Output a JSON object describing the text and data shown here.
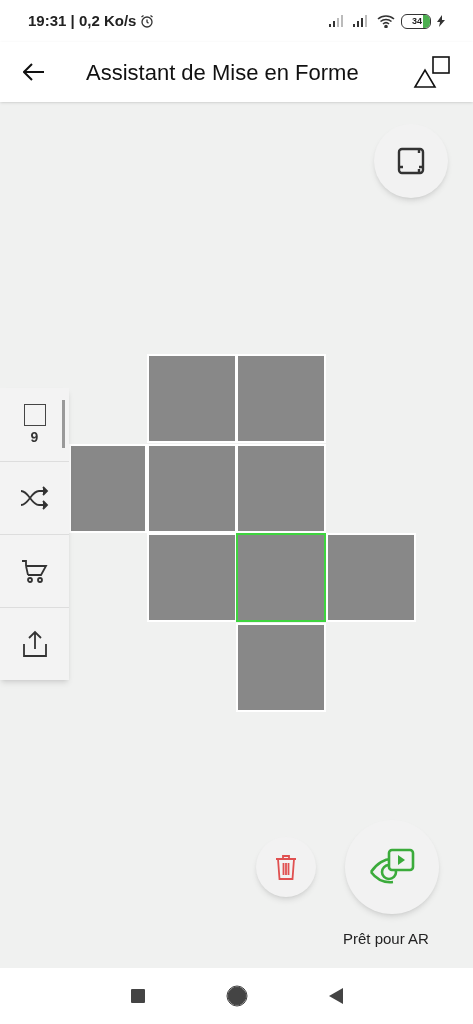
{
  "status_bar": {
    "time": "19:31 | 0,2 Ko/s",
    "battery": "34"
  },
  "app_bar": {
    "title": "Assistant de Mise en Forme"
  },
  "sidebar": [
    {
      "kind": "count",
      "label": "9"
    },
    {
      "kind": "shuffle"
    },
    {
      "kind": "cart"
    },
    {
      "kind": "share"
    }
  ],
  "tiles": [
    {
      "selected": false
    },
    {
      "selected": false
    },
    {
      "selected": false
    },
    {
      "selected": false
    },
    {
      "selected": false
    },
    {
      "selected": false
    },
    {
      "selected": true
    },
    {
      "selected": false
    },
    {
      "selected": false
    }
  ],
  "ar_button": {
    "label": "Prêt pour AR"
  }
}
